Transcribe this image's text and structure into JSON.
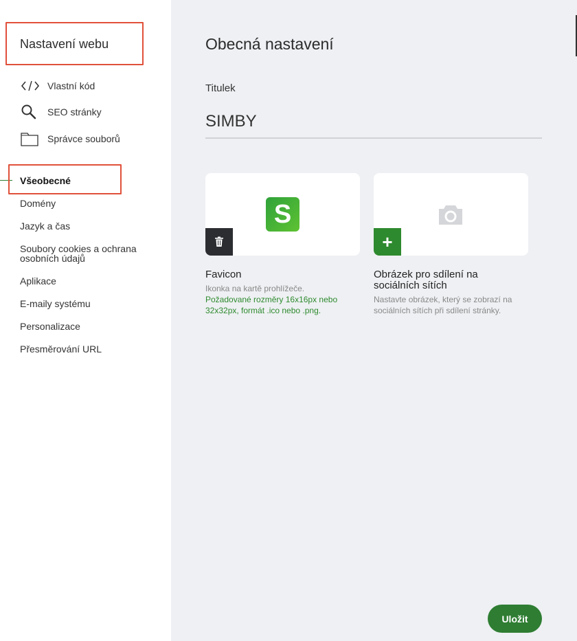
{
  "sidebar": {
    "title": "Nastavení webu",
    "tools": [
      {
        "label": "Vlastní kód",
        "icon": "code-icon"
      },
      {
        "label": "SEO stránky",
        "icon": "search-icon"
      },
      {
        "label": "Správce souborů",
        "icon": "folder-icon"
      }
    ],
    "nav": [
      {
        "label": "Všeobecné",
        "active": true
      },
      {
        "label": "Domény"
      },
      {
        "label": "Jazyk a čas"
      },
      {
        "label": "Soubory cookies a ochrana osobních údajů"
      },
      {
        "label": "Aplikace"
      },
      {
        "label": "E-maily systému"
      },
      {
        "label": "Personalizace"
      },
      {
        "label": "Přesměrování URL"
      }
    ]
  },
  "main": {
    "title": "Obecná nastavení",
    "titulek_label": "Titulek",
    "titulek_value": "SIMBY",
    "favicon": {
      "logo_letter": "S",
      "title": "Favicon",
      "desc": "Ikonka na kartě prohlížeče.",
      "requirement": "Požadované rozměry 16x16px nebo 32x32px, formát .ico nebo .png."
    },
    "share_image": {
      "add_symbol": "+",
      "title": "Obrázek pro sdílení na sociálních sítích",
      "desc": "Nastavte obrázek, který se zobrazí na sociálních sítích při sdílení stránky."
    },
    "save_label": "Uložit"
  },
  "colors": {
    "accent": "#2e7d32",
    "highlight": "#e0503a",
    "main_bg": "#eef0f3"
  }
}
